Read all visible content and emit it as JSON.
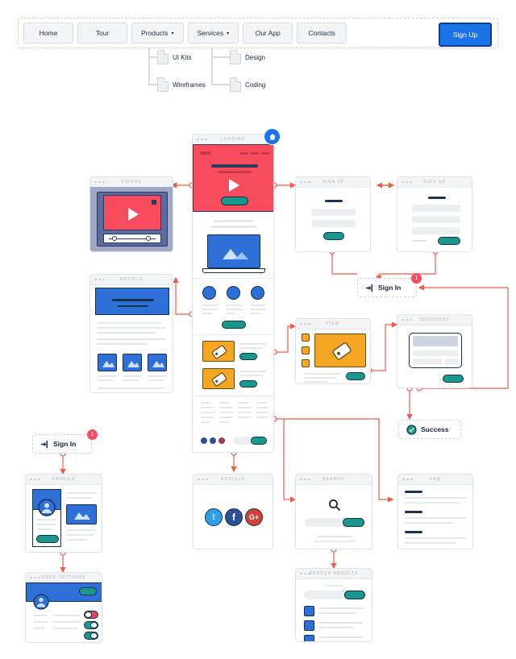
{
  "nav": {
    "items": [
      {
        "label": "Home",
        "caret": false
      },
      {
        "label": "Tour",
        "caret": false
      },
      {
        "label": "Products",
        "caret": true
      },
      {
        "label": "Services",
        "caret": true
      },
      {
        "label": "Our App",
        "caret": false
      },
      {
        "label": "Contacts",
        "caret": false
      }
    ],
    "signup_label": "Sign Up",
    "submenus": [
      {
        "parent": "Products",
        "items": [
          "UI Kits",
          "Wireframes"
        ]
      },
      {
        "parent": "Services",
        "items": [
          "Design",
          "Coding"
        ]
      }
    ],
    "caret_glyph": "▾"
  },
  "cards": {
    "landing": "LANDING",
    "videos": "VIDEOS",
    "article": "ARTICLE",
    "signin": "SIGN IN",
    "signup": "SIGN UP",
    "item": "ITEM",
    "checkout": "CHECKOUT",
    "profile": "PROFILE",
    "user_settings": "USER SETTINGS",
    "socials": "SOCIALS",
    "search": "SEARCH",
    "faq": "FAQ",
    "search_results": "SEARCH RESULTS"
  },
  "callouts": [
    {
      "id": "signin-right",
      "label": "Sign In",
      "badge": "1",
      "icon": "login-icon"
    },
    {
      "id": "signin-left",
      "label": "Sign In",
      "badge": "1",
      "icon": "login-icon"
    },
    {
      "id": "success",
      "label": "Success",
      "badge": "",
      "icon": "check-circle-icon"
    }
  ],
  "socials": {
    "icons": [
      {
        "name": "twitter-icon",
        "glyph": "t",
        "color": "#2f9fe8"
      },
      {
        "name": "facebook-icon",
        "glyph": "f",
        "color": "#2d4f93"
      },
      {
        "name": "googleplus-icon",
        "glyph": "G+",
        "color": "#d44139"
      }
    ]
  },
  "home_badge": {
    "name": "home-icon"
  },
  "colors": {
    "accent_red": "#f94b5e",
    "accent_blue": "#2f6fd8",
    "accent_teal": "#18998c",
    "accent_orange": "#f5a623",
    "navy": "#14314a",
    "connector": "#f05a47",
    "signup_blue": "#1a73e8",
    "card_border": "#dfe3e8",
    "muted": "#e4e8ec"
  }
}
